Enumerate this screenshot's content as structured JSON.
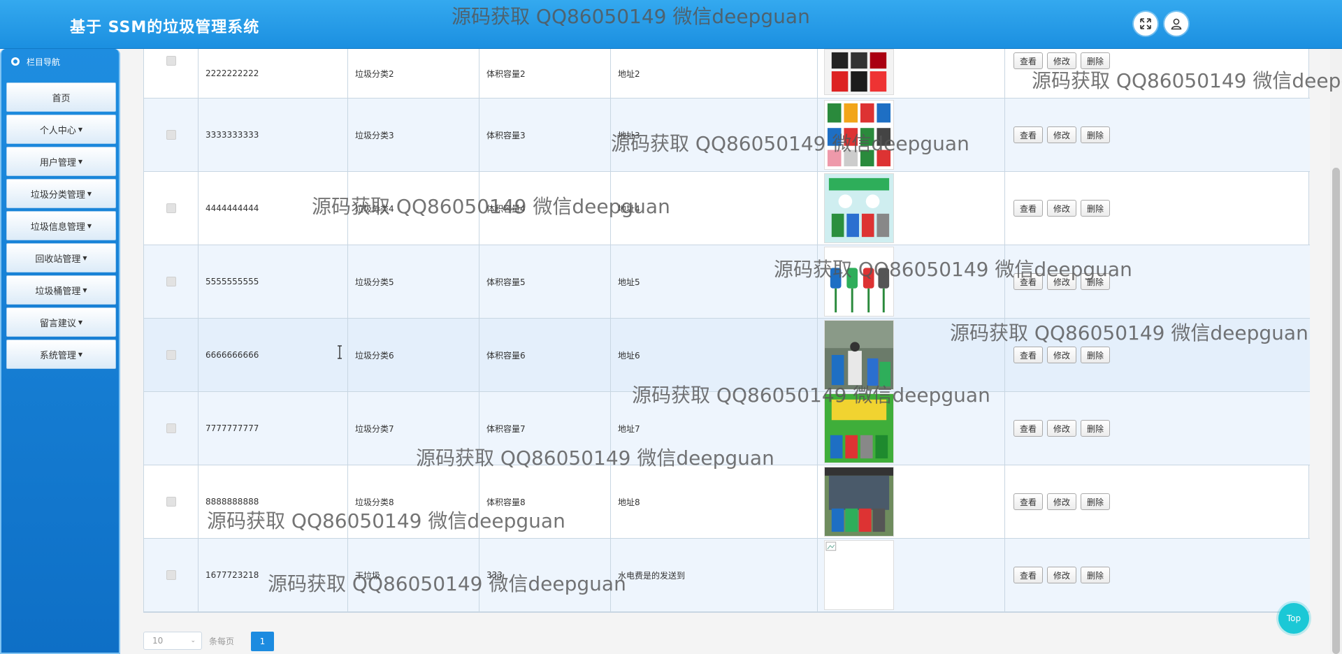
{
  "header": {
    "title": "基于 SSM的垃圾管理系统",
    "fullscreen_icon": "expand-icon",
    "user_icon": "user-icon"
  },
  "sidebar": {
    "title": "栏目导航",
    "items": [
      {
        "label": "首页",
        "has_caret": false
      },
      {
        "label": "个人中心",
        "has_caret": true
      },
      {
        "label": "用户管理",
        "has_caret": true
      },
      {
        "label": "垃圾分类管理",
        "has_caret": true
      },
      {
        "label": "垃圾信息管理",
        "has_caret": true
      },
      {
        "label": "回收站管理",
        "has_caret": true
      },
      {
        "label": "垃圾桶管理",
        "has_caret": true
      },
      {
        "label": "留言建议",
        "has_caret": true
      },
      {
        "label": "系统管理",
        "has_caret": true
      }
    ]
  },
  "table": {
    "rows": [
      {
        "id": "2222222222",
        "category": "垃圾分类2",
        "volume": "体积容量2",
        "address": "地址2",
        "image": "recycle-bins-red"
      },
      {
        "id": "3333333333",
        "category": "垃圾分类3",
        "volume": "体积容量3",
        "address": "地址3",
        "image": "sorting-poster"
      },
      {
        "id": "4444444444",
        "category": "垃圾分类4",
        "volume": "体积容量4",
        "address": "地址4",
        "image": "sorting-green"
      },
      {
        "id": "5555555555",
        "category": "垃圾分类5",
        "volume": "体积容量5",
        "address": "地址5",
        "image": "bins-flowers"
      },
      {
        "id": "6666666666",
        "category": "垃圾分类6",
        "volume": "体积容量6",
        "address": "地址6",
        "image": "street-photo"
      },
      {
        "id": "7777777777",
        "category": "垃圾分类7",
        "volume": "体积容量7",
        "address": "地址7",
        "image": "green-poster"
      },
      {
        "id": "8888888888",
        "category": "垃圾分类8",
        "volume": "体积容量8",
        "address": "地址8",
        "image": "bin-station"
      },
      {
        "id": "1677723218",
        "category": "干垃圾",
        "volume": "333",
        "address": "水电费是的发送到",
        "image": "broken"
      }
    ],
    "actions": {
      "view": "查看",
      "edit": "修改",
      "delete": "删除"
    }
  },
  "pagination": {
    "page_size": "10",
    "per_page_label": "条每页",
    "current_page": "1"
  },
  "top_button": "Top",
  "watermark": "源码获取 QQ86050149 微信deepguan"
}
